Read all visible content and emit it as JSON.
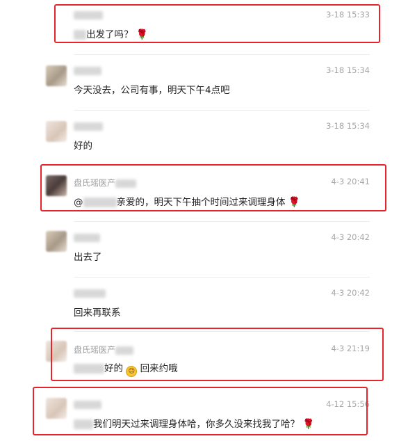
{
  "messages": [
    {
      "sender": "",
      "time": "3-18 15:33",
      "prefix_hidden": true,
      "text": "出发了吗？",
      "emoji": "rose-icon"
    },
    {
      "sender": "",
      "time": "3-18 15:34",
      "text": "今天没去，公司有事，明天下午4点吧"
    },
    {
      "sender": "",
      "time": "3-18 15:34",
      "text": "好的"
    },
    {
      "sender": "盘氏瑶医产",
      "time": "4-3 20:41",
      "mention": "@",
      "text": "亲爱的，明天下午抽个时间过来调理身体",
      "emoji": "rose-icon"
    },
    {
      "sender": "",
      "time": "4-3 20:42",
      "text": "出去了"
    },
    {
      "sender": "",
      "time": "4-3 20:42",
      "text": "回来再联系"
    },
    {
      "sender": "盘氏瑶医产",
      "time": "4-3 21:19",
      "text_a": "好的",
      "text_b": "回来约哦",
      "emoji": "smile-icon"
    },
    {
      "sender": "",
      "time": "4-12 15:56",
      "text": "我们明天过来调理身体哈，你多久没来找我了哈？",
      "emoji": "rose-icon"
    }
  ],
  "glyphs": {
    "rose": "🌹",
    "smile": "☺"
  },
  "highlight_color": "#e8242b"
}
